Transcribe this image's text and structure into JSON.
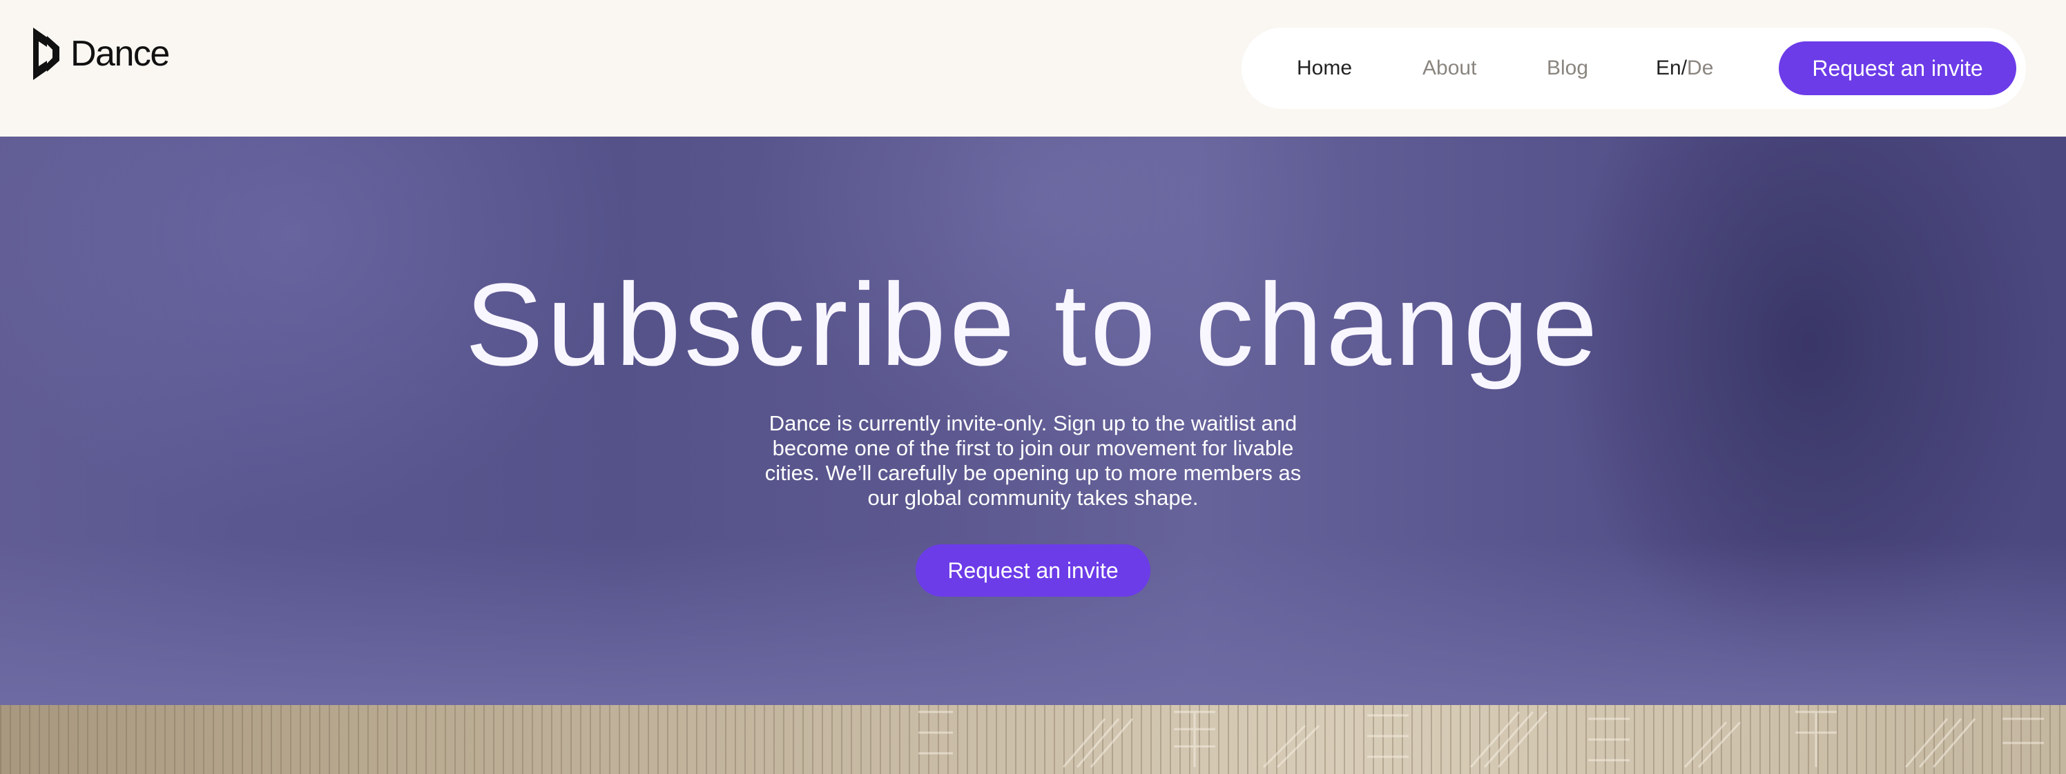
{
  "brand": {
    "name": "Dance",
    "logo_icon": "dance-logo-icon"
  },
  "nav": {
    "items": [
      {
        "label": "Home",
        "active": true
      },
      {
        "label": "About",
        "active": false
      },
      {
        "label": "Blog",
        "active": false
      }
    ],
    "language": {
      "current": "En",
      "separator": "/",
      "other": "De"
    },
    "cta_label": "Request an invite"
  },
  "hero": {
    "title": "Subscribe to change",
    "description": "Dance is currently invite-only. Sign up to the waitlist and become one of the first to join our movement for livable cities. We’ll carefully be opening up to more members as our global community takes shape.",
    "cta_label": "Request an invite"
  },
  "colors": {
    "accent": "#6c3ce8",
    "header_bg": "#faf7f2",
    "hero_bg": "#5c588f",
    "text_dark": "#222222",
    "text_muted": "#8a857f"
  }
}
